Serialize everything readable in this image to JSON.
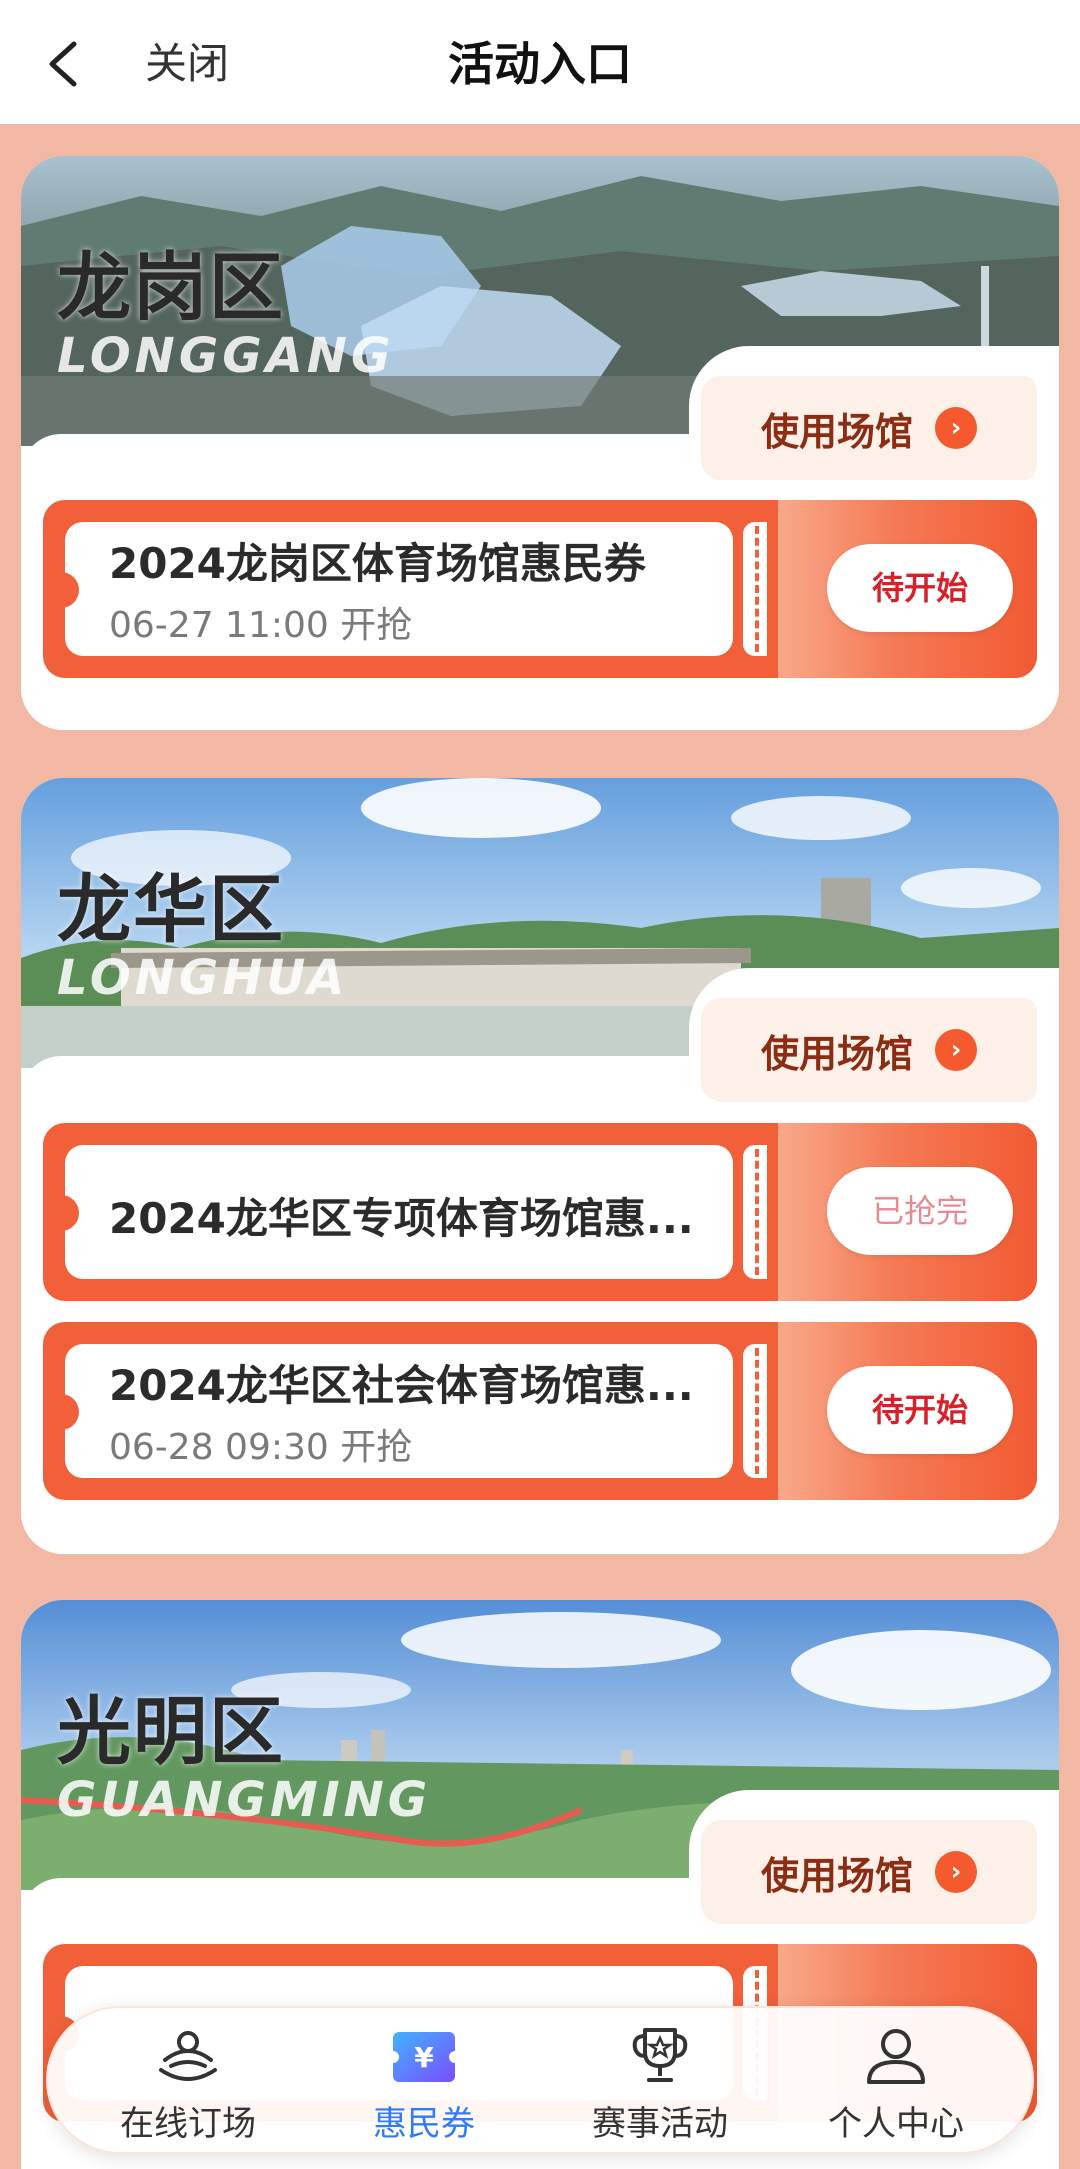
{
  "header": {
    "title": "活动入口",
    "close_label": "关闭"
  },
  "districts": [
    {
      "name": "龙岗区",
      "name_en": "LONGGANG",
      "venue_button": "使用场馆",
      "coupons": [
        {
          "title": "2024龙岗区体育场馆惠民券",
          "subtitle": "06-27 11:00 开抢",
          "status": "待开始"
        }
      ]
    },
    {
      "name": "龙华区",
      "name_en": "LONGHUA",
      "venue_button": "使用场馆",
      "coupons": [
        {
          "title": "2024龙华区专项体育场馆惠...",
          "status": "已抢完"
        },
        {
          "title": "2024龙华区社会体育场馆惠...",
          "subtitle": "06-28 09:30 开抢",
          "status": "待开始"
        }
      ]
    },
    {
      "name": "光明区",
      "name_en": "GUANGMING",
      "venue_button": "使用场馆"
    }
  ],
  "bottom_nav": {
    "items": [
      {
        "label": "在线订场",
        "icon": "stadium-icon"
      },
      {
        "label": "惠民券",
        "icon": "coupon-yen-icon",
        "active": true
      },
      {
        "label": "赛事活动",
        "icon": "trophy-icon"
      },
      {
        "label": "个人中心",
        "icon": "user-icon"
      }
    ]
  },
  "colors": {
    "page_bg": "#f2b8a4",
    "coupon_orange": "#f2603a",
    "active_nav": "#2f7cf6",
    "status_red": "#d9202a"
  }
}
